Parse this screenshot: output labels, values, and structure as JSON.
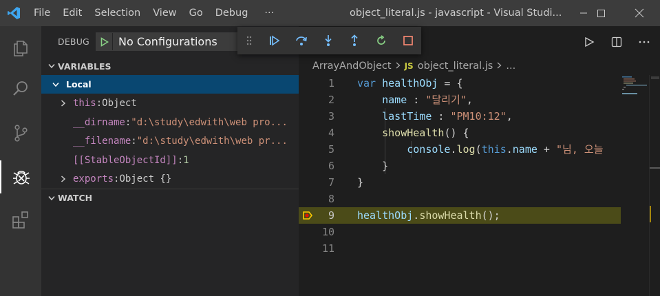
{
  "window": {
    "title": "object_literal.js - javascript - Visual Studi...",
    "menu": [
      "File",
      "Edit",
      "Selection",
      "View",
      "Go",
      "Debug",
      "···"
    ]
  },
  "activity_bar": {
    "icons": [
      "files-icon",
      "search-icon",
      "source-control-icon",
      "debug-icon",
      "extensions-icon"
    ]
  },
  "debug": {
    "label": "DEBUG",
    "configuration": "No Configurations",
    "toolbar": [
      "grip-icon",
      "continue-icon",
      "step-over-icon",
      "step-into-icon",
      "step-out-icon",
      "restart-icon",
      "stop-icon"
    ]
  },
  "variables": {
    "header": "VARIABLES",
    "scope": "Local",
    "items": [
      {
        "arrow": true,
        "name": "this",
        "value": "Object",
        "kind": "plain"
      },
      {
        "arrow": false,
        "name": "__dirname",
        "value": "\"d:\\study\\edwith\\web pro...",
        "kind": "string"
      },
      {
        "arrow": false,
        "name": "__filename",
        "value": "\"d:\\study\\edwith\\web pr...",
        "kind": "string"
      },
      {
        "arrow": false,
        "name": "[[StableObjectId]]",
        "value": "1",
        "kind": "number"
      },
      {
        "arrow": true,
        "name": "exports",
        "value": "Object {}",
        "kind": "plain"
      }
    ]
  },
  "watch": {
    "header": "WATCH"
  },
  "breadcrumb": {
    "folder": "ArrayAndObject",
    "badge": "JS",
    "file": "object_literal.js",
    "more": "..."
  },
  "editor": {
    "current_line": 9,
    "line_numbers": [
      "1",
      "2",
      "3",
      "4",
      "5",
      "6",
      "7",
      "8",
      "9",
      "10",
      "11"
    ],
    "lines": [
      [
        [
          "kw",
          "var "
        ],
        [
          "id",
          "healthObj"
        ],
        [
          "pl",
          " = {"
        ]
      ],
      [
        [
          "pl",
          "    "
        ],
        [
          "id",
          "name"
        ],
        [
          "pl",
          " : "
        ],
        [
          "str",
          "\"달리기\""
        ],
        [
          "pl",
          ","
        ]
      ],
      [
        [
          "pl",
          "    "
        ],
        [
          "id",
          "lastTime"
        ],
        [
          "pl",
          " : "
        ],
        [
          "str",
          "\"PM10:12\""
        ],
        [
          "pl",
          ","
        ]
      ],
      [
        [
          "pl",
          "    "
        ],
        [
          "fn",
          "showHealth"
        ],
        [
          "pl",
          "() {"
        ]
      ],
      [
        [
          "pl",
          "        "
        ],
        [
          "id",
          "console"
        ],
        [
          "pl",
          "."
        ],
        [
          "fn",
          "log"
        ],
        [
          "pl",
          "("
        ],
        [
          "kw",
          "this"
        ],
        [
          "pl",
          "."
        ],
        [
          "id",
          "name"
        ],
        [
          "pl",
          " + "
        ],
        [
          "str",
          "\"님, 오늘"
        ]
      ],
      [
        [
          "pl",
          "    }"
        ]
      ],
      [
        [
          "pl",
          "}"
        ]
      ],
      [],
      [
        [
          "id",
          "healthObj"
        ],
        [
          "pl",
          "."
        ],
        [
          "fn",
          "showHealth"
        ],
        [
          "pl",
          "();"
        ]
      ],
      [],
      []
    ]
  },
  "colors": {
    "accent_blue": "#007acc",
    "selection": "#094771",
    "current_line": "#4b4b18",
    "breakpoint": "#e51400",
    "stack_frame": "#ffcc00",
    "green": "#89d185",
    "stop_red": "#f48771"
  }
}
